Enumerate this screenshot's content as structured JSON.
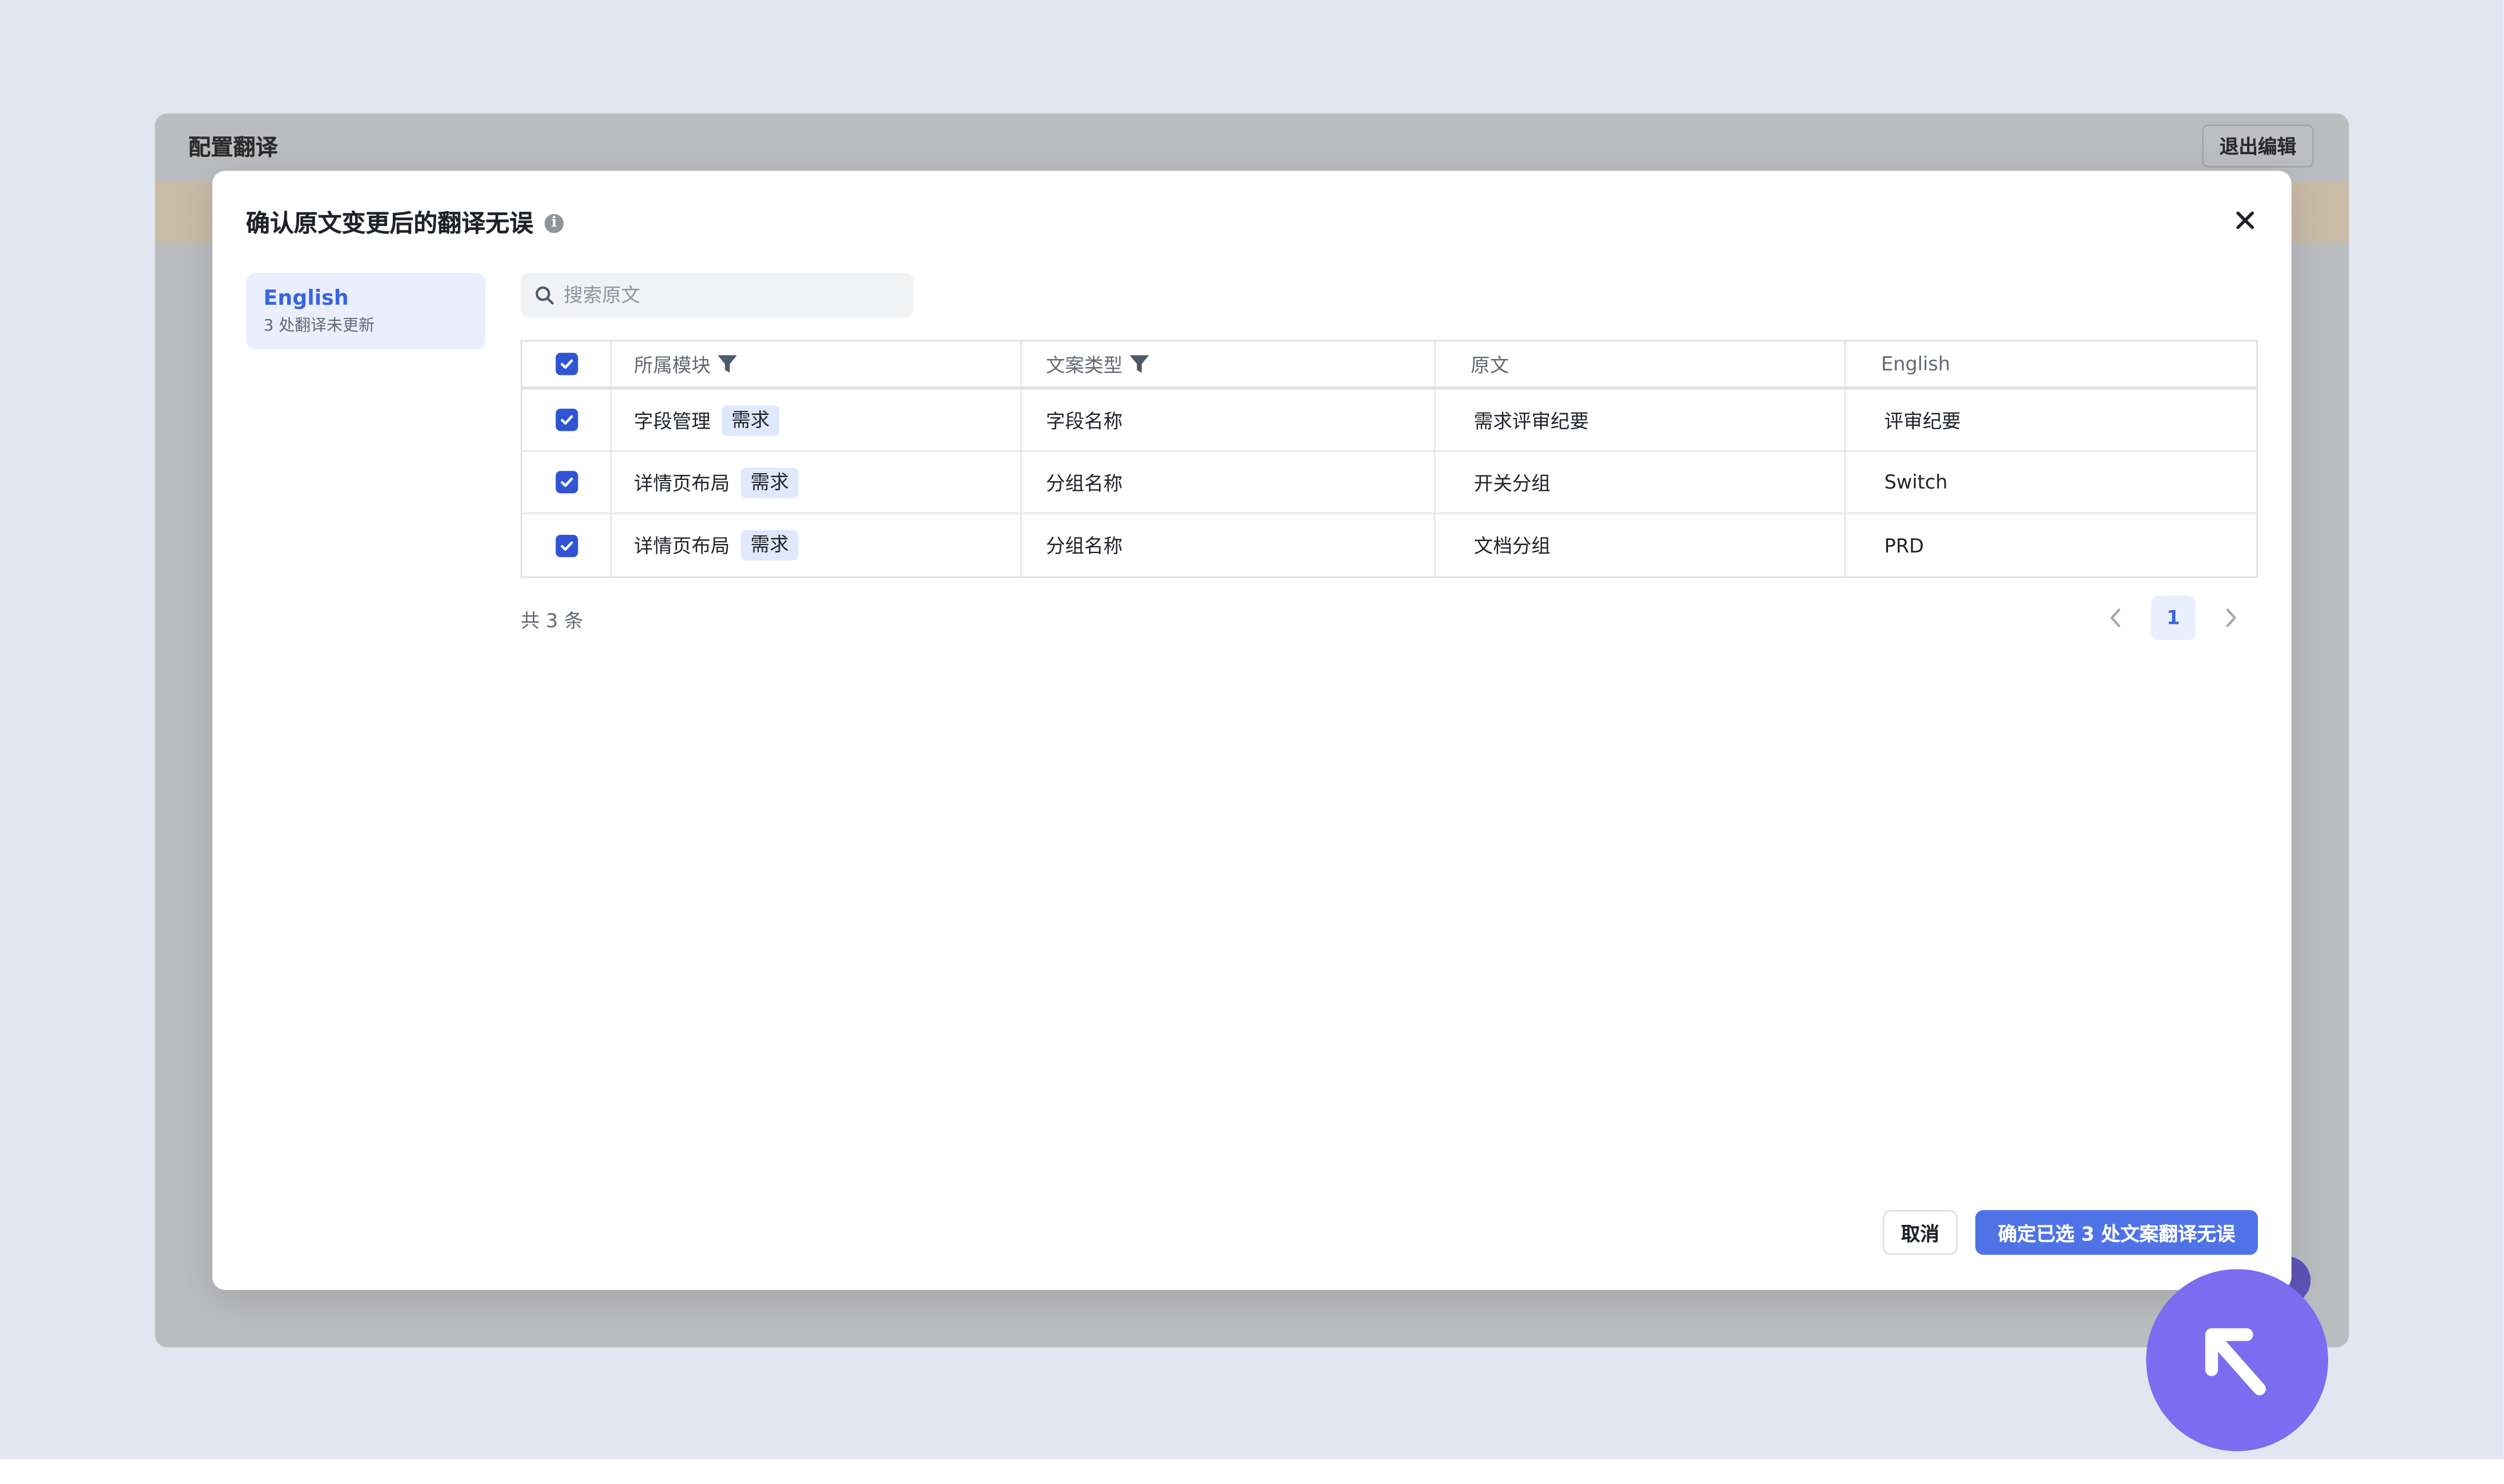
{
  "app": {
    "title": "配置翻译",
    "exit_label": "退出编辑"
  },
  "modal": {
    "title": "确认原文变更后的翻译无误",
    "info_glyph": "i",
    "close_glyph": "close-icon"
  },
  "languages": [
    {
      "name": "English",
      "subtitle": "3 处翻译未更新",
      "selected": true
    }
  ],
  "search": {
    "placeholder": "搜索原文",
    "value": ""
  },
  "table": {
    "headers": [
      "所属模块",
      "文案类型",
      "原文",
      "English"
    ],
    "header_checked": true,
    "rows": [
      {
        "checked": true,
        "module": "字段管理",
        "tag": "需求",
        "type": "字段名称",
        "source": "需求评审纪要",
        "translation": "评审纪要"
      },
      {
        "checked": true,
        "module": "详情页布局",
        "tag": "需求",
        "type": "分组名称",
        "source": "开关分组",
        "translation": "Switch"
      },
      {
        "checked": true,
        "module": "详情页布局",
        "tag": "需求",
        "type": "分组名称",
        "source": "文档分组",
        "translation": "PRD"
      }
    ]
  },
  "footer": {
    "total_text": "共 3 条",
    "current_page": "1"
  },
  "actions": {
    "cancel_label": "取消",
    "confirm_label": "确定已选 3 处文案翻译无误"
  },
  "colors": {
    "primary": "#4f73e6",
    "checkbox": "#2f55d4",
    "tag_bg": "#dfe8fd",
    "cursor_bubble": "#7c6cf0"
  }
}
